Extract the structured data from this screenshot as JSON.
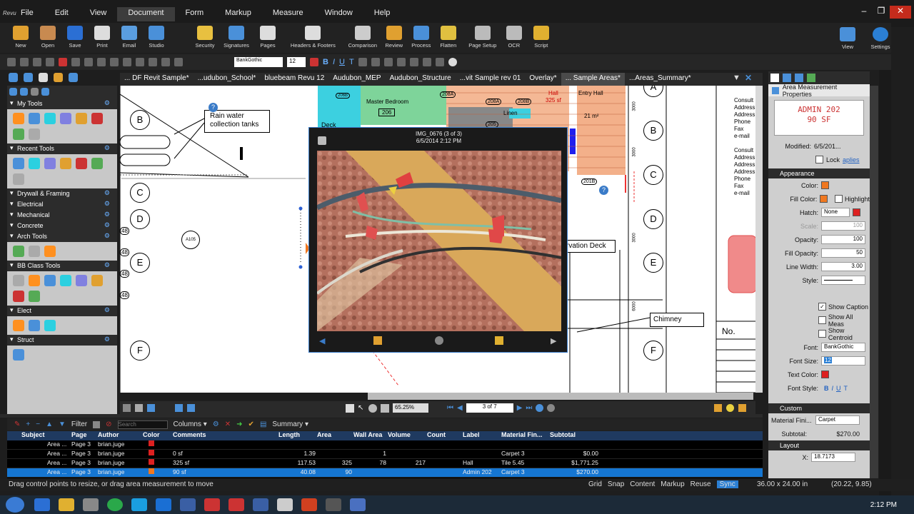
{
  "app_logo_text": "Revu",
  "menu": [
    "File",
    "Edit",
    "View",
    "Document",
    "Form",
    "Markup",
    "Measure",
    "Window",
    "Help"
  ],
  "menu_active": "Document",
  "ribbon": [
    "New",
    "Open",
    "Save",
    "Print",
    "Email",
    "Studio",
    "Security",
    "Signatures",
    "Pages",
    "Headers & Footers",
    "Comparison",
    "Review",
    "Process",
    "Flatten",
    "Page Setup",
    "OCR",
    "Script"
  ],
  "ribbon_right": [
    "View",
    "Settings"
  ],
  "font_name": "BankGothic",
  "font_size": "12",
  "left_panel": {
    "sections": [
      {
        "title": "My Tools",
        "count": 8
      },
      {
        "title": "Recent Tools",
        "count": 7
      },
      {
        "title": "Drywall & Framing",
        "count": 0
      },
      {
        "title": "Electrical",
        "count": 0
      },
      {
        "title": "Mechanical",
        "count": 0
      },
      {
        "title": "Concrete",
        "count": 0
      },
      {
        "title": "Arch Tools",
        "count": 3
      },
      {
        "title": "BB Class Tools",
        "count": 8
      },
      {
        "title": "Elect",
        "count": 3
      },
      {
        "title": "Struct",
        "count": 1
      }
    ]
  },
  "tabs": [
    "... DF Revit Sample*",
    "...udubon_School*",
    "bluebeam Revu 12",
    "Audubon_MEP",
    "Audubon_Structure",
    "...vit Sample rev 01",
    "Overlay*",
    "... Sample Areas*",
    "...Areas_Summary*"
  ],
  "tab_active": "... Sample Areas*",
  "drawing": {
    "grid_left": [
      "B",
      "C",
      "D",
      "E",
      "F"
    ],
    "grid_right": [
      "A",
      "B",
      "C",
      "D",
      "E",
      "F"
    ],
    "callout_rain": "Rain water collection tanks",
    "callout_chimney": "Chimney",
    "callout_deck": "rvation Deck",
    "rooms": {
      "master": "Master Bedroom",
      "master_num": "206",
      "linen": "Linen",
      "hall": "Hall",
      "hall_area": "325 sf",
      "entry": "Entry Hall",
      "entry_num": "21 m²",
      "deck": "Deck",
      "r208": "208A",
      "r208b": "208B",
      "r206b": "206B",
      "r201b": "201B",
      "r205": "205"
    },
    "tag_a105": "A105",
    "tag_48": "48",
    "dims": [
      "3000",
      "3000",
      "3000",
      "6000"
    ],
    "no_label": "No.",
    "consult": [
      "Consult",
      "Address",
      "Address",
      "Phone",
      "Fax",
      "e-mail",
      "",
      "Consult",
      "Address",
      "Address",
      "Address",
      "Phone",
      "Fax",
      "e-mail"
    ]
  },
  "photo": {
    "caption": "IMG_0676 (3 of 3)",
    "date": "6/5/2014 2:12 PM"
  },
  "nav": {
    "zoom": "65.25%",
    "page": "3 of 7"
  },
  "right_panel": {
    "title": "Area Measurement Properties",
    "preview_line1": "ADMIN 202",
    "preview_line2": "90 SF",
    "modified_label": "Modified:",
    "modified_value": "6/5/201...",
    "lock_label": "Lock",
    "applies": "aplies",
    "appearance": "Appearance",
    "color_label": "Color:",
    "fill_color_label": "Fill Color:",
    "highlight_label": "Highlight",
    "hatch_label": "Hatch:",
    "hatch_value": "None",
    "scale_label": "Scale:",
    "scale_value": "100",
    "opacity_label": "Opacity:",
    "opacity_value": "100",
    "fill_opacity_label": "Fill Opacity:",
    "fill_opacity_value": "50",
    "line_width_label": "Line Width:",
    "line_width_value": "3.00",
    "style_label": "Style:",
    "show_caption": "Show Caption",
    "show_all_meas": "Show All Meas",
    "show_centroid": "Show Centroid",
    "font_label": "Font:",
    "font_value": "BankGothic",
    "font_size_label": "Font Size:",
    "font_size_value": "12",
    "text_color_label": "Text Color:",
    "font_style_label": "Font Style:",
    "font_styles": [
      "B",
      "I",
      "U",
      "T"
    ],
    "custom": "Custom",
    "material_label": "Material Fini...",
    "material_value": "Carpet",
    "subtotal_label": "Subtotal:",
    "subtotal_value": "$270.00",
    "layout": "Layout",
    "x_label": "X:",
    "x_value": "18.7173",
    "colors": {
      "line": "#f07820",
      "fill": "#f07820",
      "hatch": "#dd2020",
      "text": "#dd2020"
    }
  },
  "list_toolbar": {
    "filter": "Filter",
    "search_placeholder": "Search",
    "columns": "Columns",
    "summary": "Summary"
  },
  "grid": {
    "headers": [
      "Subject",
      "Page",
      "Author",
      "Color",
      "Comments",
      "Length",
      "Area",
      "Wall Area",
      "Volume",
      "Count",
      "Label",
      "Material Fin...",
      "Subtotal"
    ],
    "rows": [
      [
        "Area ...",
        "Page 3",
        "brian.juge",
        "#dd2020",
        "",
        "",
        "",
        "",
        "",
        "",
        "",
        "",
        ""
      ],
      [
        "Area ...",
        "Page 3",
        "brian.juge",
        "#dd2020",
        "0 sf",
        "1.39",
        "",
        "1",
        "",
        "",
        "",
        "Carpet   3",
        "$0.00"
      ],
      [
        "Area ...",
        "Page 3",
        "brian.juge",
        "#dd2020",
        "325 sf",
        "117.53",
        "325",
        "78",
        "217",
        "",
        "Hall",
        "Tile   5.45",
        "$1,771.25"
      ],
      [
        "Area ...",
        "Page 3",
        "brian.juge",
        "#f07820",
        "90 sf",
        "40.08",
        "90",
        "",
        "",
        "",
        "Admin 202",
        "Carpet   3",
        "$270.00"
      ]
    ],
    "selected": 3
  },
  "status": {
    "hint": "Drag control points to resize, or drag area measurement to move",
    "toggles": [
      "Grid",
      "Snap",
      "Content",
      "Markup",
      "Reuse",
      "Sync"
    ],
    "page_size": "36.00 x 24.00 in",
    "coords": "(20.22, 9.85)"
  },
  "taskbar": {
    "time": "2:12 PM"
  }
}
